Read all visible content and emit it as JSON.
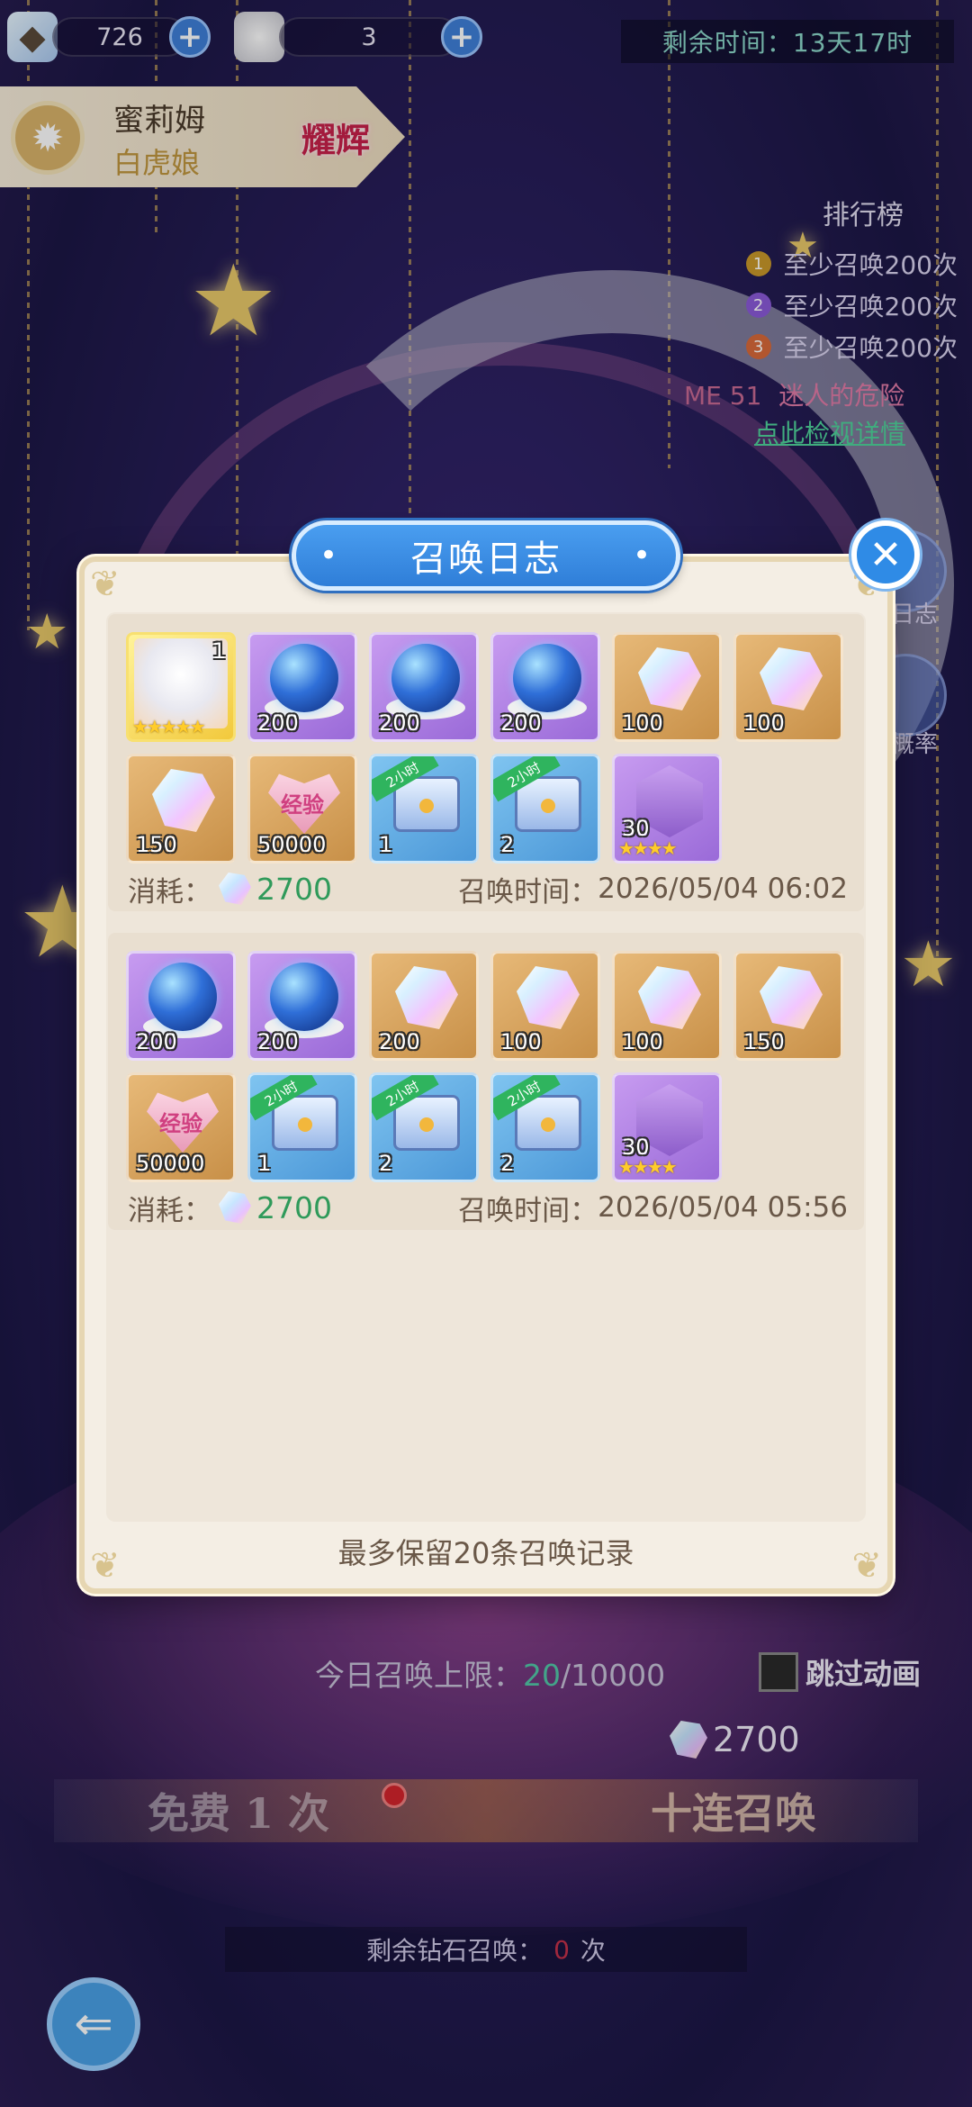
{
  "currencies": {
    "crystal_amount": "726",
    "fur_amount": "3",
    "plus_label": "+"
  },
  "event": {
    "remaining_time_label": "剩余时间：",
    "remaining_time_value": "13天17时"
  },
  "character": {
    "name": "蜜莉姆",
    "subtitle": "白虎娘",
    "badge": "耀辉"
  },
  "ranking": {
    "title": "排行榜",
    "rows": [
      {
        "rank": "1",
        "text": "至少召唤200次",
        "color": "#c8982a"
      },
      {
        "rank": "2",
        "text": "至少召唤200次",
        "color": "#8a5ad8"
      },
      {
        "rank": "3",
        "text": "至少召唤200次",
        "color": "#d86a3a"
      }
    ],
    "extra_prefix": "ME 51",
    "extra_text": "迷人的危险",
    "link_text": "点此检视详情"
  },
  "side_buttons": {
    "log_label": "日志",
    "rate_label": "概率"
  },
  "modal": {
    "title": "召唤日志",
    "close_label": "✕",
    "note": "最多保留20条召唤记录",
    "cost_label": "消耗：",
    "time_label": "召唤时间：",
    "records": [
      {
        "cost": "2700",
        "time": "2026/05/04 06:02",
        "items": [
          {
            "type": "character",
            "count": "1",
            "stars": "★★★★★",
            "color": "gold"
          },
          {
            "type": "sphere",
            "count": "200",
            "color": "purple"
          },
          {
            "type": "sphere",
            "count": "200",
            "color": "purple"
          },
          {
            "type": "sphere",
            "count": "200",
            "color": "purple"
          },
          {
            "type": "crystal",
            "count": "100",
            "color": "orange"
          },
          {
            "type": "crystal",
            "count": "100",
            "color": "orange"
          },
          {
            "type": "crystal",
            "count": "150",
            "color": "orange"
          },
          {
            "type": "exp",
            "count": "50000",
            "label": "经验",
            "color": "orange"
          },
          {
            "type": "chest",
            "count": "1",
            "ribbon": "2小时",
            "color": "blue"
          },
          {
            "type": "chest",
            "count": "2",
            "ribbon": "2小时",
            "color": "blue"
          },
          {
            "type": "shard",
            "count": "30",
            "stars": "★★★★",
            "color": "purple"
          }
        ]
      },
      {
        "cost": "2700",
        "time": "2026/05/04 05:56",
        "items": [
          {
            "type": "sphere",
            "count": "200",
            "color": "purple"
          },
          {
            "type": "sphere",
            "count": "200",
            "color": "purple"
          },
          {
            "type": "crystal",
            "count": "200",
            "color": "orange"
          },
          {
            "type": "crystal",
            "count": "100",
            "color": "orange"
          },
          {
            "type": "crystal",
            "count": "100",
            "color": "orange"
          },
          {
            "type": "crystal",
            "count": "150",
            "color": "orange"
          },
          {
            "type": "exp",
            "count": "50000",
            "label": "经验",
            "color": "orange"
          },
          {
            "type": "chest",
            "count": "1",
            "ribbon": "2小时",
            "color": "blue"
          },
          {
            "type": "chest",
            "count": "2",
            "ribbon": "2小时",
            "color": "blue"
          },
          {
            "type": "chest",
            "count": "2",
            "ribbon": "2小时",
            "color": "blue"
          },
          {
            "type": "shard",
            "count": "30",
            "stars": "★★★★",
            "color": "purple"
          }
        ]
      }
    ]
  },
  "bottom": {
    "daily_limit_label": "今日召唤上限：",
    "daily_limit_current": "20",
    "daily_limit_max": "/10000",
    "skip_animation": "跳过动画",
    "cost": "2700",
    "free_button": "免费 1 次",
    "ten_button": "十连召唤",
    "remaining_label": "剩余钻石召唤：",
    "remaining_value": "0",
    "remaining_unit": "次"
  },
  "colors": {
    "accent_blue": "#2f8be6",
    "cost_green": "#2f9a5a",
    "time_teal": "#8ad6c8"
  }
}
